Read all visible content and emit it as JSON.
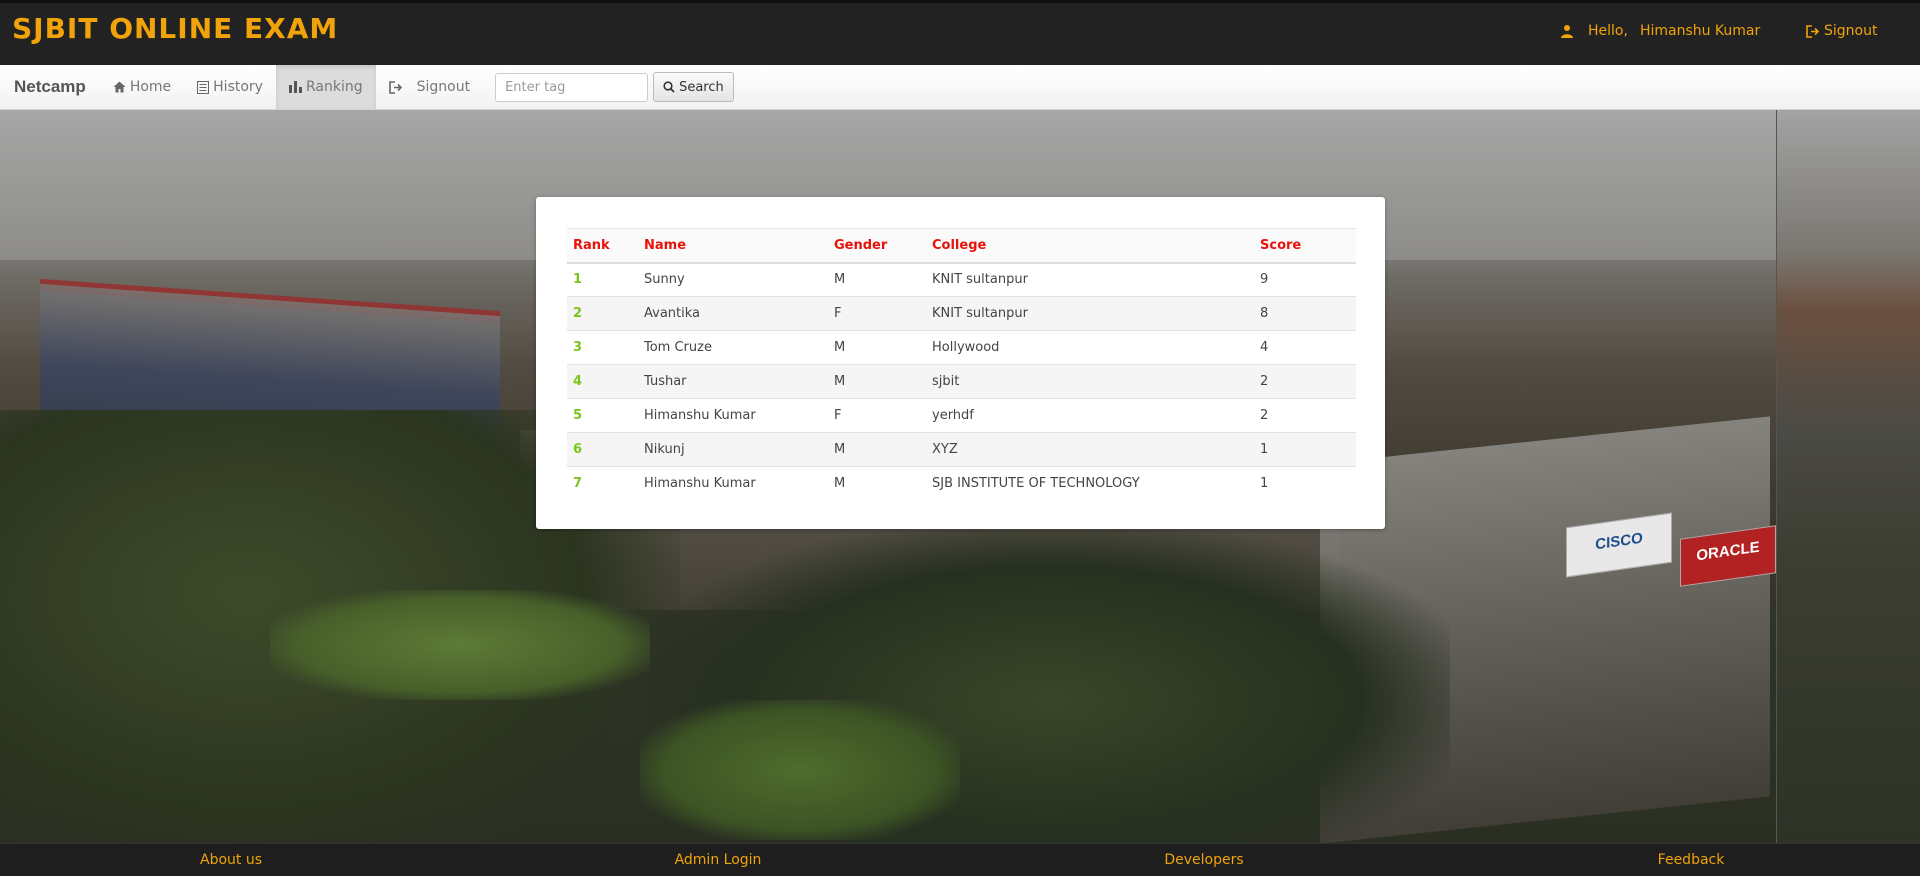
{
  "header": {
    "title": "SJBIT ONLINE EXAM",
    "greeting": "Hello,",
    "username": "Himanshu Kumar",
    "signout_label": "Signout",
    "accent_color": "#f0a30a"
  },
  "navbar": {
    "brand": "Netcamp",
    "items": [
      {
        "label": "Home",
        "icon": "home-icon"
      },
      {
        "label": "History",
        "icon": "list-icon"
      },
      {
        "label": "Ranking",
        "icon": "bar-chart-icon",
        "active": true
      },
      {
        "label": "Signout",
        "icon": "signout-icon"
      }
    ],
    "search": {
      "placeholder": "Enter tag",
      "button_label": "Search"
    }
  },
  "ranking": {
    "headers": {
      "rank": "Rank",
      "name": "Name",
      "gender": "Gender",
      "college": "College",
      "score": "Score"
    },
    "header_color": "#e8120c",
    "rank_color": "#7cc51a",
    "rows": [
      {
        "rank": "1",
        "name": "Sunny",
        "gender": "M",
        "college": "KNIT sultanpur",
        "score": "9"
      },
      {
        "rank": "2",
        "name": "Avantika",
        "gender": "F",
        "college": "KNIT sultanpur",
        "score": "8"
      },
      {
        "rank": "3",
        "name": "Tom Cruze",
        "gender": "M",
        "college": "Hollywood",
        "score": "4"
      },
      {
        "rank": "4",
        "name": "Tushar",
        "gender": "M",
        "college": "sjbit",
        "score": "2"
      },
      {
        "rank": "5",
        "name": "Himanshu Kumar",
        "gender": "F",
        "college": "yerhdf",
        "score": "2"
      },
      {
        "rank": "6",
        "name": "Nikunj",
        "gender": "M",
        "college": "XYZ",
        "score": "1"
      },
      {
        "rank": "7",
        "name": "Himanshu Kumar",
        "gender": "M",
        "college": "SJB INSTITUTE OF TECHNOLOGY",
        "score": "1"
      }
    ]
  },
  "background_signs": {
    "cisco": "CISCO",
    "oracle": "ORACLE"
  },
  "footer": {
    "links": [
      "About us",
      "Admin Login",
      "Developers",
      "Feedback"
    ]
  }
}
